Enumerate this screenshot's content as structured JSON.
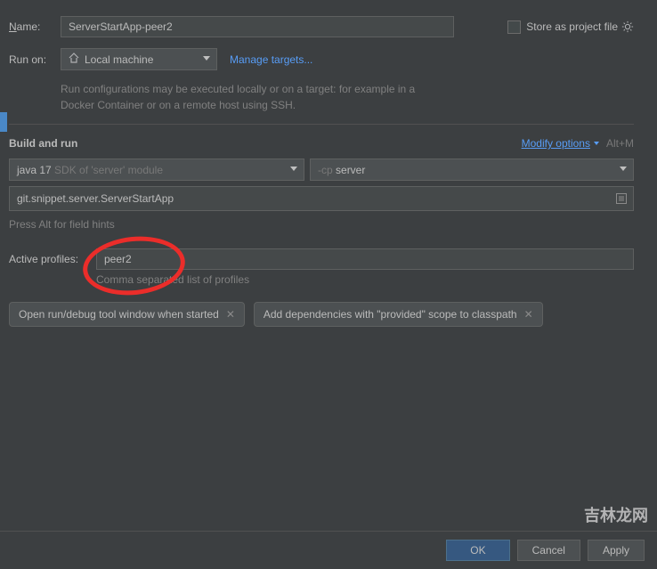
{
  "name": {
    "label_pre": "N",
    "label_post": "ame:",
    "value": "ServerStartApp-peer2"
  },
  "store": {
    "label_pre": "S",
    "label_post": "tore as project file"
  },
  "run_on": {
    "label": "Run on:",
    "target": "Local machine",
    "manage": "Manage targets...",
    "hint": "Run configurations may be executed locally or on a target: for example in a Docker Container or on a remote host using SSH."
  },
  "build": {
    "title": "Build and run",
    "modify_pre": "M",
    "modify_post": "odify options",
    "shortcut": "Alt+M",
    "sdk_bold": "java 17",
    "sdk_dim": " SDK of 'server' module",
    "cp_prefix": "-cp",
    "cp_module": "server",
    "main_class": "git.snippet.server.ServerStartApp",
    "alt_hint": "Press Alt for field hints"
  },
  "profiles": {
    "label": "Active profiles:",
    "value": "peer2",
    "hint": "Comma separated list of profiles"
  },
  "chips": {
    "c1": "Open run/debug tool window when started",
    "c2": "Add dependencies with \"provided\" scope to classpath"
  },
  "footer": {
    "ok": "OK",
    "cancel": "Cancel",
    "apply_pre": "A",
    "apply_post": "pply"
  },
  "watermark": "吉林龙网"
}
